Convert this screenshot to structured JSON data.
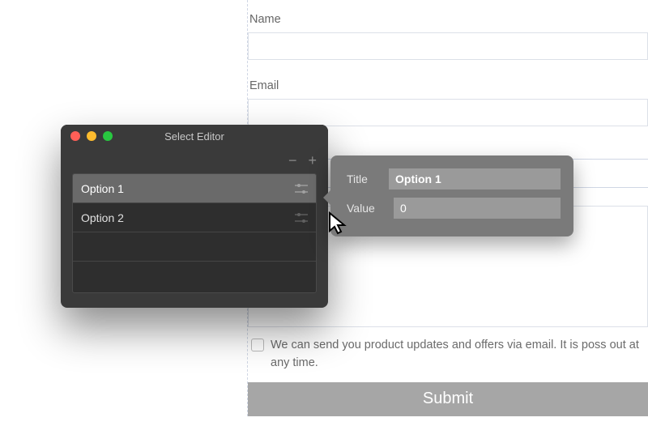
{
  "form": {
    "name_label": "Name",
    "email_label": "Email",
    "checkbox_text": "We can send you product updates and offers via email. It is poss            out at any time.",
    "submit_label": "Submit"
  },
  "editor": {
    "title": "Select Editor",
    "options": [
      {
        "label": "Option 1"
      },
      {
        "label": "Option 2"
      }
    ]
  },
  "popover": {
    "title_label": "Title",
    "title_value": "Option 1",
    "value_label": "Value",
    "value_value": "0"
  }
}
